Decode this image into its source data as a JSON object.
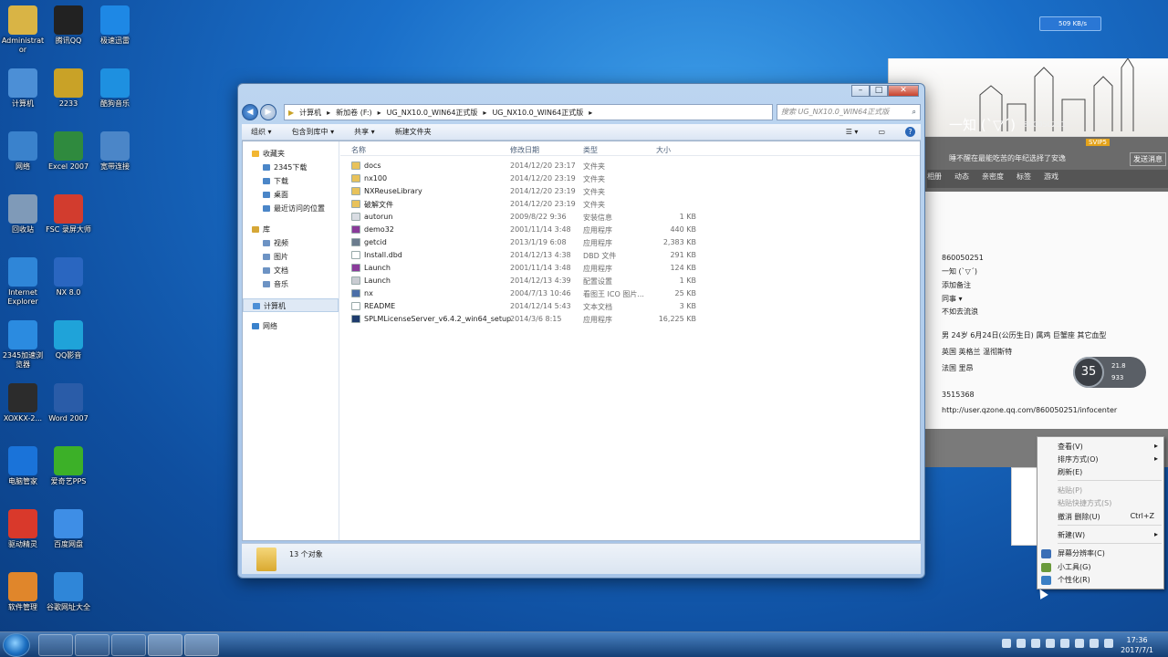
{
  "desktop_icons": [
    {
      "label": "Administrat or",
      "color": "#d9b445"
    },
    {
      "label": "腾讯QQ",
      "color": "#222222"
    },
    {
      "label": "极速迅雷",
      "color": "#1e88e5"
    },
    {
      "label": "计算机",
      "color": "#4c8fd6"
    },
    {
      "label": "2233",
      "color": "#c9a227"
    },
    {
      "label": "酷狗音乐",
      "color": "#1e90e0"
    },
    {
      "label": "网络",
      "color": "#3a82cc"
    },
    {
      "label": "Excel 2007",
      "color": "#2f8a3e"
    },
    {
      "label": "宽带连接",
      "color": "#4b86c8"
    },
    {
      "label": "回收站",
      "color": "#7f9ab8"
    },
    {
      "label": "FSC 录屏大师",
      "color": "#d23c2e"
    },
    {
      "label": "Internet Explorer",
      "color": "#2f86d8"
    },
    {
      "label": "NX 8.0",
      "color": "#2a66c0"
    },
    {
      "label": "2345加速浏览器",
      "color": "#2b8be0"
    },
    {
      "label": "QQ影音",
      "color": "#1fa3d9"
    },
    {
      "label": "XOXKX-2...",
      "color": "#2c2c2c"
    },
    {
      "label": "Word 2007",
      "color": "#2a5ca8"
    },
    {
      "label": "电脑管家",
      "color": "#1a73d9"
    },
    {
      "label": "爱奇艺PPS",
      "color": "#3cb028"
    },
    {
      "label": "驱动精灵",
      "color": "#d9392b"
    },
    {
      "label": "百度网盘",
      "color": "#3e8ee6"
    },
    {
      "label": "软件管理",
      "color": "#e0862b"
    },
    {
      "label": "谷歌网址大全",
      "color": "#2f86d8"
    }
  ],
  "explorer": {
    "breadcrumb": [
      "计算机",
      "新加卷 (F:)",
      "UG_NX10.0_WIN64正式版",
      "UG_NX10.0_WIN64正式版"
    ],
    "search_placeholder": "搜索 UG_NX10.0_WIN64正式版",
    "toolbar": [
      "组织 ▾",
      "包含到库中 ▾",
      "共享 ▾",
      "新建文件夹"
    ],
    "nav": {
      "favorites": "收藏夹",
      "fav_items": [
        "2345下载",
        "下载",
        "桌面",
        "最近访问的位置"
      ],
      "libraries": "库",
      "lib_items": [
        "视频",
        "图片",
        "文档",
        "音乐"
      ],
      "computer": "计算机",
      "network": "网络"
    },
    "columns": [
      "名称",
      "修改日期",
      "类型",
      "大小"
    ],
    "files": [
      {
        "name": "docs",
        "date": "2014/12/20 23:17",
        "type": "文件夹",
        "size": "",
        "color": "#e8c25a"
      },
      {
        "name": "nx100",
        "date": "2014/12/20 23:19",
        "type": "文件夹",
        "size": "",
        "color": "#e8c25a"
      },
      {
        "name": "NXReuseLibrary",
        "date": "2014/12/20 23:19",
        "type": "文件夹",
        "size": "",
        "color": "#e8c25a"
      },
      {
        "name": "破解文件",
        "date": "2014/12/20 23:19",
        "type": "文件夹",
        "size": "",
        "color": "#e8c25a"
      },
      {
        "name": "autorun",
        "date": "2009/8/22 9:36",
        "type": "安装信息",
        "size": "1 KB",
        "color": "#d9dde3"
      },
      {
        "name": "demo32",
        "date": "2001/11/14 3:48",
        "type": "应用程序",
        "size": "440 KB",
        "color": "#8a3b9a"
      },
      {
        "name": "getcid",
        "date": "2013/1/19 6:08",
        "type": "应用程序",
        "size": "2,383 KB",
        "color": "#6b7c8e"
      },
      {
        "name": "Install.dbd",
        "date": "2014/12/13 4:38",
        "type": "DBD 文件",
        "size": "291 KB",
        "color": "#ffffff"
      },
      {
        "name": "Launch",
        "date": "2001/11/14 3:48",
        "type": "应用程序",
        "size": "124 KB",
        "color": "#8a3b9a"
      },
      {
        "name": "Launch",
        "date": "2014/12/13 4:39",
        "type": "配置设置",
        "size": "1 KB",
        "color": "#c9ccd2"
      },
      {
        "name": "nx",
        "date": "2004/7/13 10:46",
        "type": "看图王 ICO 图片...",
        "size": "25 KB",
        "color": "#4b6fa8"
      },
      {
        "name": "README",
        "date": "2014/12/14 5:43",
        "type": "文本文档",
        "size": "3 KB",
        "color": "#ffffff"
      },
      {
        "name": "SPLMLicenseServer_v6.4.2_win64_setup",
        "date": "2014/3/6 8:15",
        "type": "应用程序",
        "size": "16,225 KB",
        "color": "#1f3c6e"
      }
    ],
    "status": "13 个对象"
  },
  "qq_panel": {
    "name": "一知 (`▽´)",
    "qq_id_header": "860050251",
    "status_text": "睡不醒在最能吃苦的年纪选择了安逸",
    "send_button": "发送消息",
    "svip": "SVIP5",
    "tabs": [
      "相册",
      "动态",
      "亲密度",
      "标签",
      "游戏"
    ],
    "info_lines": [
      "860050251",
      "一知 (`▽´)",
      "添加备注",
      "同事 ▾",
      "不如去流浪",
      "男    24岁    6月24日(公历生日)    属鸡    巨蟹座    其它血型",
      "英国 英格兰 温彻斯特",
      "法国 里昂",
      "3515368",
      "http://user.qzone.qq.com/860050251/infocenter"
    ]
  },
  "context_menu": {
    "items": [
      {
        "label": "查看(V)",
        "arrow": "▸",
        "disabled": false
      },
      {
        "label": "排序方式(O)",
        "arrow": "▸",
        "disabled": false
      },
      {
        "label": "刷新(E)",
        "arrow": "",
        "disabled": false
      },
      {
        "label": "粘贴(P)",
        "arrow": "",
        "disabled": true
      },
      {
        "label": "粘贴快捷方式(S)",
        "arrow": "",
        "disabled": true
      },
      {
        "label": "撤消 删除(U)",
        "shortcut": "Ctrl+Z",
        "arrow": "",
        "disabled": false
      },
      {
        "label": "新建(W)",
        "arrow": "▸",
        "disabled": false
      },
      {
        "label": "屏幕分辨率(C)",
        "arrow": "",
        "disabled": false
      },
      {
        "label": "小工具(G)",
        "arrow": "",
        "disabled": false
      },
      {
        "label": "个性化(R)",
        "arrow": "",
        "disabled": false
      }
    ]
  },
  "net_speed": "509 KB/s",
  "gauge": {
    "percent": "35",
    "up": "21.8",
    "down": "933"
  },
  "clock": {
    "time": "17:36",
    "date": "2017/7/1"
  }
}
